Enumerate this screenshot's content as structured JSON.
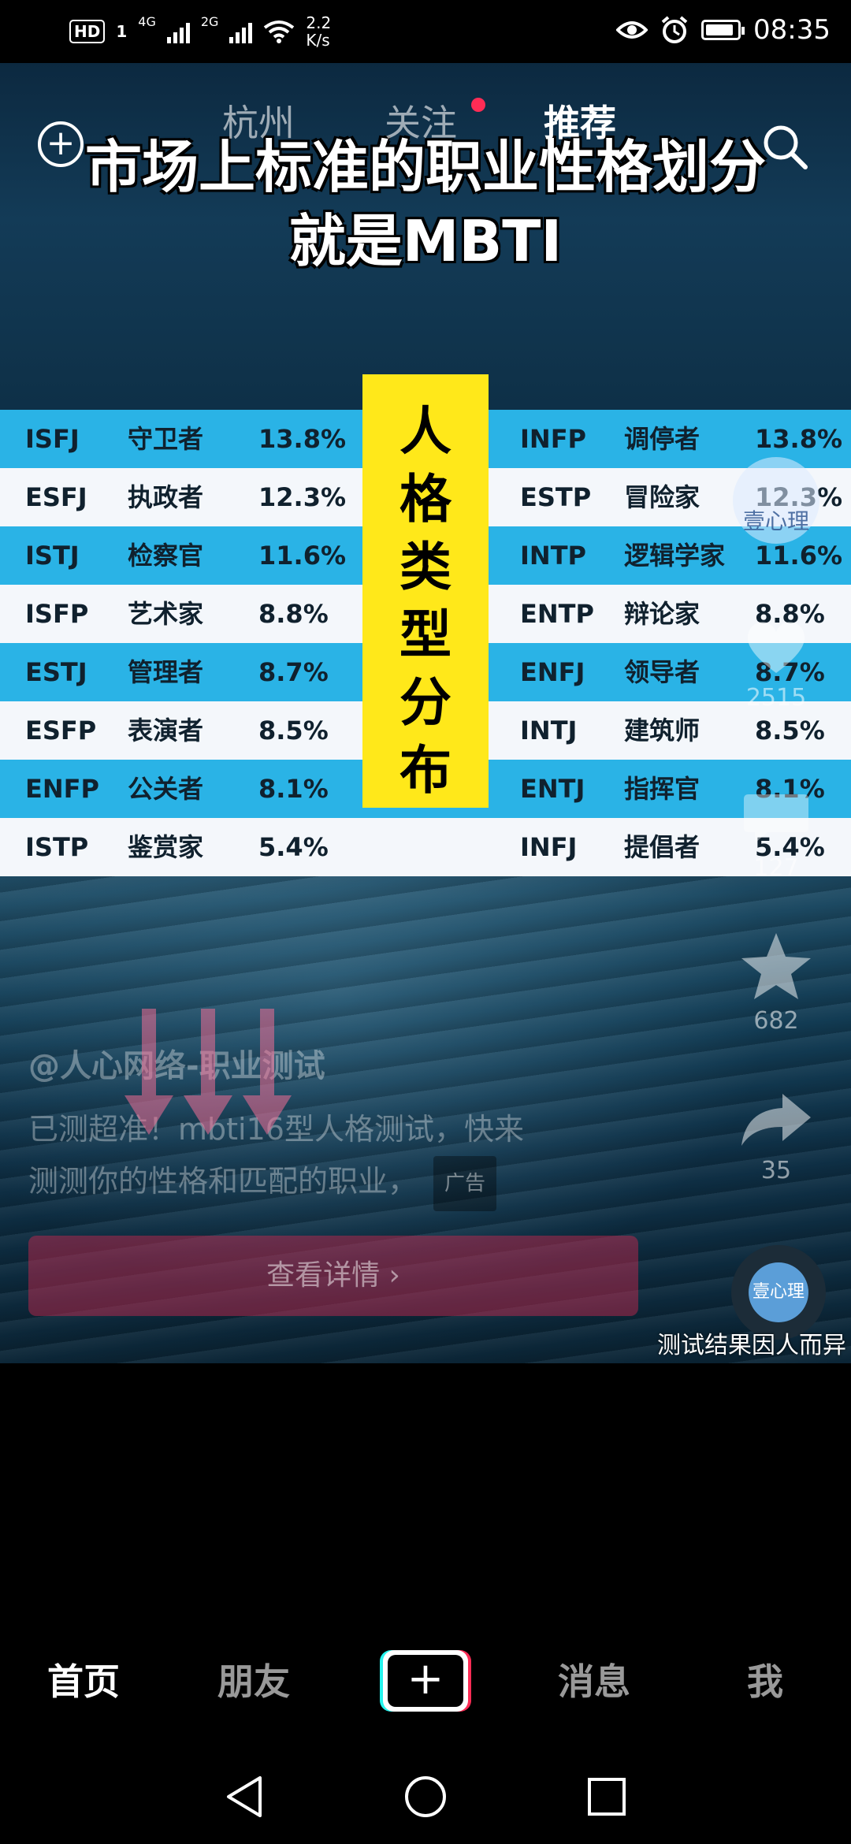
{
  "status_bar": {
    "hd": "HD",
    "sim1": "1",
    "net1": "4G",
    "net2": "2G",
    "speed_value": "2.2",
    "speed_unit": "K/s",
    "time": "08:35"
  },
  "top_nav": {
    "tabs": [
      {
        "label": "杭州"
      },
      {
        "label": "关注"
      },
      {
        "label": "推荐"
      }
    ],
    "active_tab": "推荐",
    "notification_dot_color": "#fe2c55"
  },
  "video": {
    "headline_line1": "市场上标准的职业性格划分",
    "headline_line2": "就是MBTI",
    "center_label": [
      "人",
      "格",
      "类",
      "型",
      "分",
      "布"
    ],
    "left_table": [
      {
        "code": "ISFJ",
        "name": "守卫者",
        "pct": "13.8%"
      },
      {
        "code": "ESFJ",
        "name": "执政者",
        "pct": "12.3%"
      },
      {
        "code": "ISTJ",
        "name": "检察官",
        "pct": "11.6%"
      },
      {
        "code": "ISFP",
        "name": "艺术家",
        "pct": "8.8%"
      },
      {
        "code": "ESTJ",
        "name": "管理者",
        "pct": "8.7%"
      },
      {
        "code": "ESFP",
        "name": "表演者",
        "pct": "8.5%"
      },
      {
        "code": "ENFP",
        "name": "公关者",
        "pct": "8.1%"
      },
      {
        "code": "ISTP",
        "name": "鉴赏家",
        "pct": "5.4%"
      }
    ],
    "right_table": [
      {
        "code": "INFP",
        "name": "调停者",
        "pct": "13.8%"
      },
      {
        "code": "ESTP",
        "name": "冒险家",
        "pct": "12.3%"
      },
      {
        "code": "INTP",
        "name": "逻辑学家",
        "pct": "11.6%"
      },
      {
        "code": "ENTP",
        "name": "辩论家",
        "pct": "8.8%"
      },
      {
        "code": "ENFJ",
        "name": "领导者",
        "pct": "8.7%"
      },
      {
        "code": "INTJ",
        "name": "建筑师",
        "pct": "8.5%"
      },
      {
        "code": "ENTJ",
        "name": "指挥官",
        "pct": "8.1%"
      },
      {
        "code": "INFJ",
        "name": "提倡者",
        "pct": "5.4%"
      }
    ]
  },
  "actions": {
    "avatar_label": "壹心理",
    "like_count": "2515",
    "comment_count": "127",
    "favorite_count": "682",
    "share_count": "35",
    "music_label": "壹心理"
  },
  "caption": {
    "author": "@人心网络-职业测试",
    "text_line1": "已测超准！mbti16型人格测试，快来",
    "text_line2": "测测你的性格和匹配的职业，",
    "ad_tag": "广告",
    "cta_label": "查看详情 ›",
    "disclaimer": "测试结果因人而异"
  },
  "bottom_nav": {
    "items": [
      {
        "label": "首页"
      },
      {
        "label": "朋友"
      },
      {
        "label": "消息"
      },
      {
        "label": "我"
      }
    ],
    "active": "首页",
    "plus_glyph": "+"
  },
  "colors": {
    "accent_red": "#fe2c55",
    "accent_cyan": "#25f4ee",
    "table_blue": "#2ab3e6",
    "table_yellow": "#ffe81a"
  }
}
